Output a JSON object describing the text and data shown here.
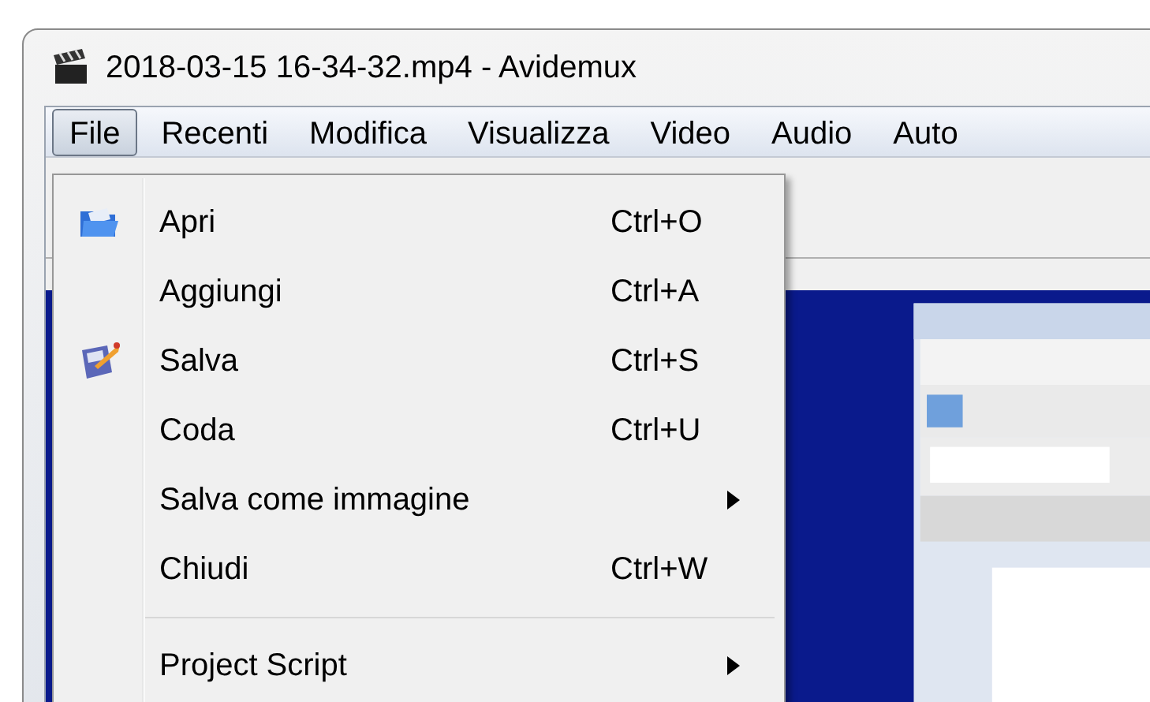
{
  "window": {
    "title": "2018-03-15 16-34-32.mp4 - Avidemux"
  },
  "menu_bar": [
    {
      "label": "File",
      "selected": true
    },
    {
      "label": "Recenti",
      "selected": false
    },
    {
      "label": "Modifica",
      "selected": false
    },
    {
      "label": "Visualizza",
      "selected": false
    },
    {
      "label": "Video",
      "selected": false
    },
    {
      "label": "Audio",
      "selected": false
    },
    {
      "label": "Auto",
      "selected": false
    }
  ],
  "file_menu": {
    "items": [
      {
        "kind": "item",
        "label": "Apri",
        "shortcut": "Ctrl+O"
      },
      {
        "kind": "item",
        "label": "Aggiungi",
        "shortcut": "Ctrl+A"
      },
      {
        "kind": "item",
        "label": "Salva",
        "shortcut": "Ctrl+S"
      },
      {
        "kind": "item",
        "label": "Coda",
        "shortcut": "Ctrl+U"
      },
      {
        "kind": "submenu",
        "label": "Salva come immagine"
      },
      {
        "kind": "item",
        "label": "Chiudi",
        "shortcut": "Ctrl+W"
      },
      {
        "kind": "separator"
      },
      {
        "kind": "submenu",
        "label": "Project Script"
      }
    ]
  }
}
